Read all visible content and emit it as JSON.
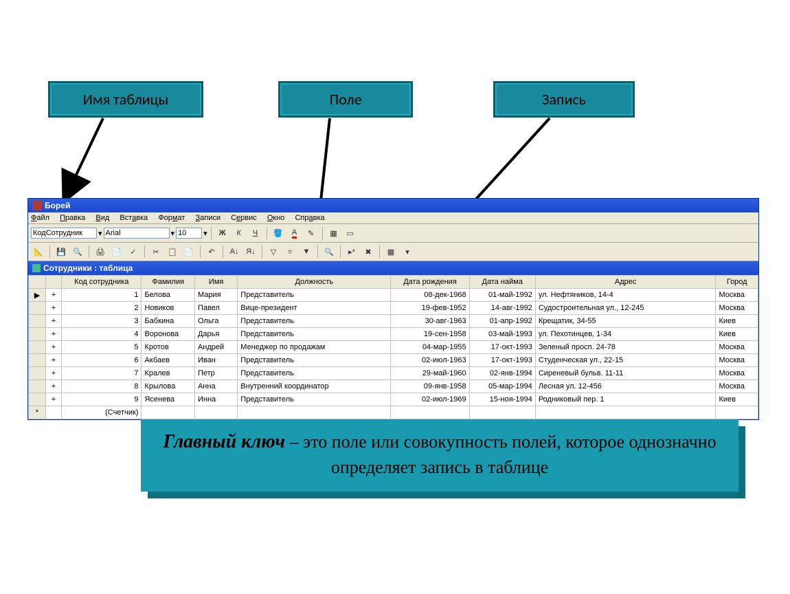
{
  "callouts": {
    "table_name": "Имя таблицы",
    "field": "Поле",
    "record": "Запись"
  },
  "app": {
    "title": "Борей",
    "menu": [
      "Файл",
      "Правка",
      "Вид",
      "Вставка",
      "Формат",
      "Записи",
      "Сервис",
      "Окно",
      "Справка"
    ],
    "format_toolbar": {
      "field_combo": "КодСотрудник",
      "font_combo": "Arial",
      "size_combo": "10"
    },
    "subwindow_title": "Сотрудники : таблица",
    "columns": [
      "Код сотрудника",
      "Фамилия",
      "Имя",
      "Должность",
      "Дата рождения",
      "Дата найма",
      "Адрес",
      "Город"
    ],
    "rows": [
      {
        "id": "1",
        "fam": "Белова",
        "name": "Мария",
        "pos": "Представитель",
        "bdate": "08-дек-1968",
        "hdate": "01-май-1992",
        "addr": "ул. Нефтяников, 14-4",
        "city": "Москва"
      },
      {
        "id": "2",
        "fam": "Новиков",
        "name": "Павел",
        "pos": "Вице-президент",
        "bdate": "19-фев-1952",
        "hdate": "14-авг-1992",
        "addr": "Судостроительная ул., 12-245",
        "city": "Москва"
      },
      {
        "id": "3",
        "fam": "Бабкина",
        "name": "Ольга",
        "pos": "Представитель",
        "bdate": "30-авг-1963",
        "hdate": "01-апр-1992",
        "addr": "Крещатик, 34-55",
        "city": "Киев"
      },
      {
        "id": "4",
        "fam": "Воронова",
        "name": "Дарья",
        "pos": "Представитель",
        "bdate": "19-сен-1958",
        "hdate": "03-май-1993",
        "addr": "ул. Пехотинцев, 1-34",
        "city": "Киев"
      },
      {
        "id": "5",
        "fam": "Кротов",
        "name": "Андрей",
        "pos": "Менеджер по продажам",
        "bdate": "04-мар-1955",
        "hdate": "17-окт-1993",
        "addr": "Зеленый просп. 24-78",
        "city": "Москва"
      },
      {
        "id": "6",
        "fam": "Акбаев",
        "name": "Иван",
        "pos": "Представитель",
        "bdate": "02-июл-1963",
        "hdate": "17-окт-1993",
        "addr": "Студенческая ул., 22-15",
        "city": "Москва"
      },
      {
        "id": "7",
        "fam": "Кралев",
        "name": "Петр",
        "pos": "Представитель",
        "bdate": "29-май-1960",
        "hdate": "02-янв-1994",
        "addr": "Сиреневый бульв. 11-11",
        "city": "Москва"
      },
      {
        "id": "8",
        "fam": "Крылова",
        "name": "Анна",
        "pos": "Внутренний координатор",
        "bdate": "09-янв-1958",
        "hdate": "05-мар-1994",
        "addr": "Лесная ул. 12-456",
        "city": "Москва"
      },
      {
        "id": "9",
        "fam": "Ясенева",
        "name": "Инна",
        "pos": "Представитель",
        "bdate": "02-июл-1969",
        "hdate": "15-ноя-1994",
        "addr": "Родниковый пер. 1",
        "city": "Киев"
      }
    ],
    "new_row_label": "(Счетчик)"
  },
  "keybox": {
    "term": "Главный ключ",
    "def": " – это поле или совокупность полей, которое однозначно определяет запись в таблице"
  }
}
